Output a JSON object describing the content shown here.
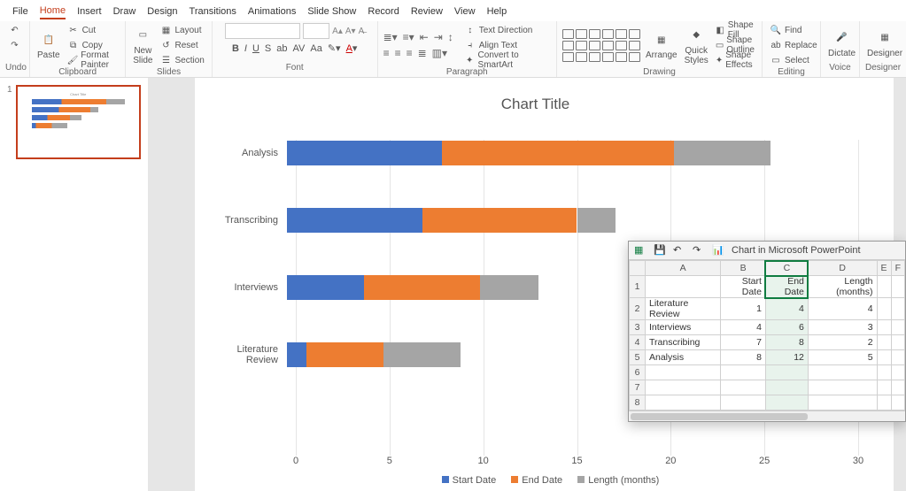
{
  "tabs": [
    "File",
    "Home",
    "Insert",
    "Draw",
    "Design",
    "Transitions",
    "Animations",
    "Slide Show",
    "Record",
    "Review",
    "View",
    "Help"
  ],
  "activeTab": "Home",
  "ribbon": {
    "undo": {
      "label": "Undo"
    },
    "clipboard": {
      "label": "Clipboard",
      "paste": "Paste",
      "cut": "Cut",
      "copy": "Copy",
      "fmt": "Format Painter"
    },
    "slides": {
      "label": "Slides",
      "new": "New\nSlide",
      "layout": "Layout",
      "reset": "Reset",
      "section": "Section"
    },
    "font": {
      "label": "Font",
      "name": "",
      "size": ""
    },
    "paragraph": {
      "label": "Paragraph",
      "textdir": "Text Direction",
      "align": "Align Text",
      "smart": "Convert to SmartArt"
    },
    "drawing": {
      "label": "Drawing",
      "arrange": "Arrange",
      "quick": "Quick\nStyles",
      "fill": "Shape Fill",
      "outline": "Shape Outline",
      "effects": "Shape Effects"
    },
    "editing": {
      "label": "Editing",
      "find": "Find",
      "replace": "Replace",
      "select": "Select"
    },
    "voice": {
      "label": "Voice",
      "dictate": "Dictate"
    },
    "designer": {
      "label": "Designer",
      "btn": "Designer"
    }
  },
  "slideThumb": {
    "num": "1"
  },
  "chart": {
    "title": "Chart Title",
    "legend": {
      "a": "Start Date",
      "b": "End Date",
      "c": "Length (months)"
    },
    "xmax": 30,
    "rows": [
      {
        "label": "Analysis",
        "a": 8,
        "b": 12,
        "c": 5
      },
      {
        "label": "Transcribing",
        "a": 7,
        "b": 8,
        "c": 2
      },
      {
        "label": "Interviews",
        "a": 4,
        "b": 6,
        "c": 3
      },
      {
        "label": "Literature Review",
        "a": 1,
        "b": 4,
        "c": 4
      }
    ],
    "xticks": [
      "0",
      "5",
      "10",
      "15",
      "20",
      "25",
      "30"
    ]
  },
  "excel": {
    "title": "Chart in Microsoft PowerPoint",
    "cols": [
      "",
      "A",
      "B",
      "C",
      "D",
      "E",
      "F"
    ],
    "head": {
      "A": "",
      "B": "Start Date",
      "C": "End Date",
      "D": "Length (months)",
      "E": "",
      "F": ""
    },
    "rows": [
      {
        "n": "1",
        "A": "",
        "B": "Start Date",
        "C": "End Date",
        "D": "Length (months)"
      },
      {
        "n": "2",
        "A": "Literature Review",
        "B": "1",
        "C": "4",
        "D": "4"
      },
      {
        "n": "3",
        "A": "Interviews",
        "B": "4",
        "C": "6",
        "D": "3"
      },
      {
        "n": "4",
        "A": "Transcribing",
        "B": "7",
        "C": "8",
        "D": "2"
      },
      {
        "n": "5",
        "A": "Analysis",
        "B": "8",
        "C": "12",
        "D": "5"
      },
      {
        "n": "6",
        "A": "",
        "B": "",
        "C": "",
        "D": ""
      },
      {
        "n": "7",
        "A": "",
        "B": "",
        "C": "",
        "D": ""
      },
      {
        "n": "8",
        "A": "",
        "B": "",
        "C": "",
        "D": ""
      }
    ]
  },
  "chart_data": {
    "type": "bar",
    "orientation": "horizontal",
    "stacked": true,
    "categories": [
      "Analysis",
      "Transcribing",
      "Interviews",
      "Literature Review"
    ],
    "series": [
      {
        "name": "Start Date",
        "values": [
          8,
          7,
          4,
          1
        ]
      },
      {
        "name": "End Date",
        "values": [
          12,
          8,
          6,
          4
        ]
      },
      {
        "name": "Length (months)",
        "values": [
          5,
          2,
          3,
          4
        ]
      }
    ],
    "title": "Chart Title",
    "xlabel": "",
    "ylabel": "",
    "xlim": [
      0,
      30
    ],
    "xticks": [
      0,
      5,
      10,
      15,
      20,
      25,
      30
    ],
    "legend_position": "bottom",
    "colors": {
      "Start Date": "#4472c4",
      "End Date": "#ed7d31",
      "Length (months)": "#a5a5a5"
    }
  }
}
